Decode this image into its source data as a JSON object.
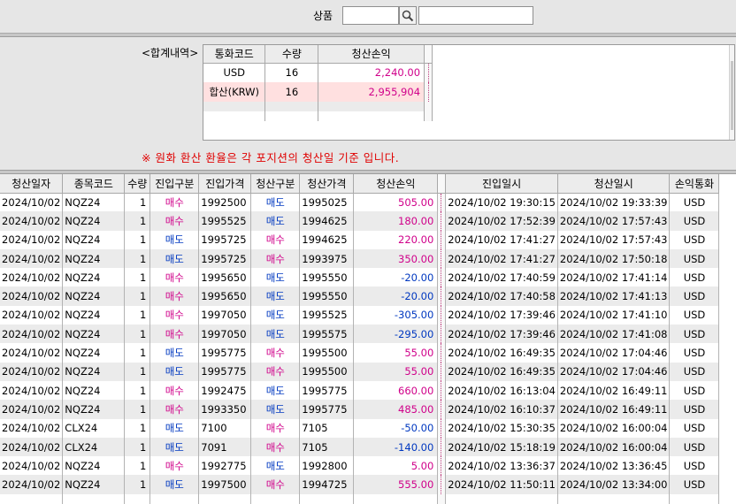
{
  "search": {
    "label": "상품",
    "code_value": "",
    "name_value": ""
  },
  "summary": {
    "title": "<합계내역>",
    "columns": [
      "통화코드",
      "수량",
      "청산손익"
    ],
    "rows": [
      {
        "currency": "USD",
        "qty": "16",
        "pnl": "2,240.00"
      },
      {
        "currency": "합산(KRW)",
        "qty": "16",
        "pnl": "2,955,904"
      }
    ],
    "note": "※ 원화 환산 환율은 각 포지션의 청산일 기준 입니다."
  },
  "grid": {
    "columns": [
      "청산일자",
      "종목코드",
      "수량",
      "진입구분",
      "진입가격",
      "청산구분",
      "청산가격",
      "청산손익",
      "진입일시",
      "청산일시",
      "손익통화"
    ],
    "rows": [
      {
        "date": "2024/10/02",
        "code": "NQZ24",
        "qty": "1",
        "entry_side": "매수",
        "entry_price": "1992500",
        "exit_side": "매도",
        "exit_price": "1995025",
        "pnl": "505.00",
        "entry_time": "2024/10/02  19:30:15",
        "exit_time": "2024/10/02  19:33:39",
        "cur": "USD"
      },
      {
        "date": "2024/10/02",
        "code": "NQZ24",
        "qty": "1",
        "entry_side": "매수",
        "entry_price": "1995525",
        "exit_side": "매도",
        "exit_price": "1994625",
        "pnl": "180.00",
        "entry_time": "2024/10/02  17:52:39",
        "exit_time": "2024/10/02  17:57:43",
        "cur": "USD"
      },
      {
        "date": "2024/10/02",
        "code": "NQZ24",
        "qty": "1",
        "entry_side": "매도",
        "entry_price": "1995725",
        "exit_side": "매수",
        "exit_price": "1994625",
        "pnl": "220.00",
        "entry_time": "2024/10/02  17:41:27",
        "exit_time": "2024/10/02  17:57:43",
        "cur": "USD"
      },
      {
        "date": "2024/10/02",
        "code": "NQZ24",
        "qty": "1",
        "entry_side": "매도",
        "entry_price": "1995725",
        "exit_side": "매수",
        "exit_price": "1993975",
        "pnl": "350.00",
        "entry_time": "2024/10/02  17:41:27",
        "exit_time": "2024/10/02  17:50:18",
        "cur": "USD"
      },
      {
        "date": "2024/10/02",
        "code": "NQZ24",
        "qty": "1",
        "entry_side": "매수",
        "entry_price": "1995650",
        "exit_side": "매도",
        "exit_price": "1995550",
        "pnl": "-20.00",
        "entry_time": "2024/10/02  17:40:59",
        "exit_time": "2024/10/02  17:41:14",
        "cur": "USD"
      },
      {
        "date": "2024/10/02",
        "code": "NQZ24",
        "qty": "1",
        "entry_side": "매수",
        "entry_price": "1995650",
        "exit_side": "매도",
        "exit_price": "1995550",
        "pnl": "-20.00",
        "entry_time": "2024/10/02  17:40:58",
        "exit_time": "2024/10/02  17:41:13",
        "cur": "USD"
      },
      {
        "date": "2024/10/02",
        "code": "NQZ24",
        "qty": "1",
        "entry_side": "매수",
        "entry_price": "1997050",
        "exit_side": "매도",
        "exit_price": "1995525",
        "pnl": "-305.00",
        "entry_time": "2024/10/02  17:39:46",
        "exit_time": "2024/10/02  17:41:10",
        "cur": "USD"
      },
      {
        "date": "2024/10/02",
        "code": "NQZ24",
        "qty": "1",
        "entry_side": "매수",
        "entry_price": "1997050",
        "exit_side": "매도",
        "exit_price": "1995575",
        "pnl": "-295.00",
        "entry_time": "2024/10/02  17:39:46",
        "exit_time": "2024/10/02  17:41:08",
        "cur": "USD"
      },
      {
        "date": "2024/10/02",
        "code": "NQZ24",
        "qty": "1",
        "entry_side": "매도",
        "entry_price": "1995775",
        "exit_side": "매수",
        "exit_price": "1995500",
        "pnl": "55.00",
        "entry_time": "2024/10/02  16:49:35",
        "exit_time": "2024/10/02  17:04:46",
        "cur": "USD"
      },
      {
        "date": "2024/10/02",
        "code": "NQZ24",
        "qty": "1",
        "entry_side": "매도",
        "entry_price": "1995775",
        "exit_side": "매수",
        "exit_price": "1995500",
        "pnl": "55.00",
        "entry_time": "2024/10/02  16:49:35",
        "exit_time": "2024/10/02  17:04:46",
        "cur": "USD"
      },
      {
        "date": "2024/10/02",
        "code": "NQZ24",
        "qty": "1",
        "entry_side": "매수",
        "entry_price": "1992475",
        "exit_side": "매도",
        "exit_price": "1995775",
        "pnl": "660.00",
        "entry_time": "2024/10/02  16:13:04",
        "exit_time": "2024/10/02  16:49:11",
        "cur": "USD"
      },
      {
        "date": "2024/10/02",
        "code": "NQZ24",
        "qty": "1",
        "entry_side": "매수",
        "entry_price": "1993350",
        "exit_side": "매도",
        "exit_price": "1995775",
        "pnl": "485.00",
        "entry_time": "2024/10/02  16:10:37",
        "exit_time": "2024/10/02  16:49:11",
        "cur": "USD"
      },
      {
        "date": "2024/10/02",
        "code": "CLX24",
        "qty": "1",
        "entry_side": "매도",
        "entry_price": "7100",
        "exit_side": "매수",
        "exit_price": "7105",
        "pnl": "-50.00",
        "entry_time": "2024/10/02  15:30:35",
        "exit_time": "2024/10/02  16:00:04",
        "cur": "USD"
      },
      {
        "date": "2024/10/02",
        "code": "CLX24",
        "qty": "1",
        "entry_side": "매도",
        "entry_price": "7091",
        "exit_side": "매수",
        "exit_price": "7105",
        "pnl": "-140.00",
        "entry_time": "2024/10/02  15:18:19",
        "exit_time": "2024/10/02  16:00:04",
        "cur": "USD"
      },
      {
        "date": "2024/10/02",
        "code": "NQZ24",
        "qty": "1",
        "entry_side": "매수",
        "entry_price": "1992775",
        "exit_side": "매도",
        "exit_price": "1992800",
        "pnl": "5.00",
        "entry_time": "2024/10/02  13:36:37",
        "exit_time": "2024/10/02  13:36:45",
        "cur": "USD"
      },
      {
        "date": "2024/10/02",
        "code": "NQZ24",
        "qty": "1",
        "entry_side": "매도",
        "entry_price": "1997500",
        "exit_side": "매수",
        "exit_price": "1994725",
        "pnl": "555.00",
        "entry_time": "2024/10/02  11:50:11",
        "exit_time": "2024/10/02  13:34:00",
        "cur": "USD"
      }
    ]
  }
}
